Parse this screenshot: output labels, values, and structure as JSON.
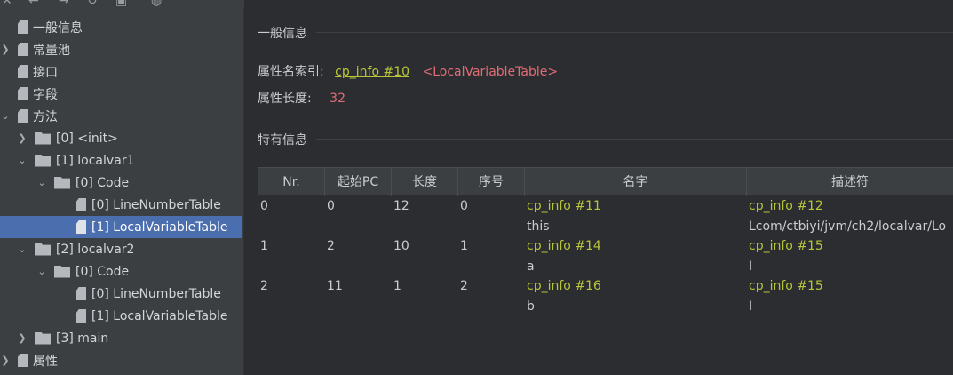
{
  "toolbar": {
    "icons": [
      "close-icon",
      "back-icon",
      "forward-icon",
      "refresh-icon",
      "save-icon",
      "globe-icon"
    ]
  },
  "tree": {
    "general_info": "一般信息",
    "constant_pool": "常量池",
    "interfaces": "接口",
    "fields": "字段",
    "methods": "方法",
    "method0": "[0] <init>",
    "method1": "[1] localvar1",
    "m1_code": "[0] Code",
    "m1_lnt": "[0] LineNumberTable",
    "m1_lvt": "[1] LocalVariableTable",
    "method2": "[2] localvar2",
    "m2_code": "[0] Code",
    "m2_lnt": "[0] LineNumberTable",
    "m2_lvt": "[1] LocalVariableTable",
    "method3": "[3] main",
    "attributes": "属性"
  },
  "main": {
    "general_title": "一般信息",
    "attr_name_label": "属性名索引:",
    "attr_name_link": "cp_info #10",
    "attr_name_value": "<LocalVariableTable>",
    "attr_len_label": "属性长度:",
    "attr_len_value": "32",
    "specific_title": "特有信息"
  },
  "table": {
    "headers": [
      "Nr.",
      "起始PC",
      "长度",
      "序号",
      "名字",
      "描述符"
    ],
    "rows": [
      {
        "nr": "0",
        "pc": "0",
        "len": "12",
        "idx": "0",
        "name_link": "cp_info #11",
        "name": "this",
        "desc_link": "cp_info #12",
        "desc": "Lcom/ctbiyi/jvm/ch2/localvar/Lo"
      },
      {
        "nr": "1",
        "pc": "2",
        "len": "10",
        "idx": "1",
        "name_link": "cp_info #14",
        "name": "a",
        "desc_link": "cp_info #15",
        "desc": "I"
      },
      {
        "nr": "2",
        "pc": "11",
        "len": "1",
        "idx": "2",
        "name_link": "cp_info #16",
        "name": "b",
        "desc_link": "cp_info #15",
        "desc": "I"
      }
    ]
  },
  "colors": {
    "link": "#b8c53a",
    "red": "#e06c75",
    "selected": "#4b6eaf"
  }
}
